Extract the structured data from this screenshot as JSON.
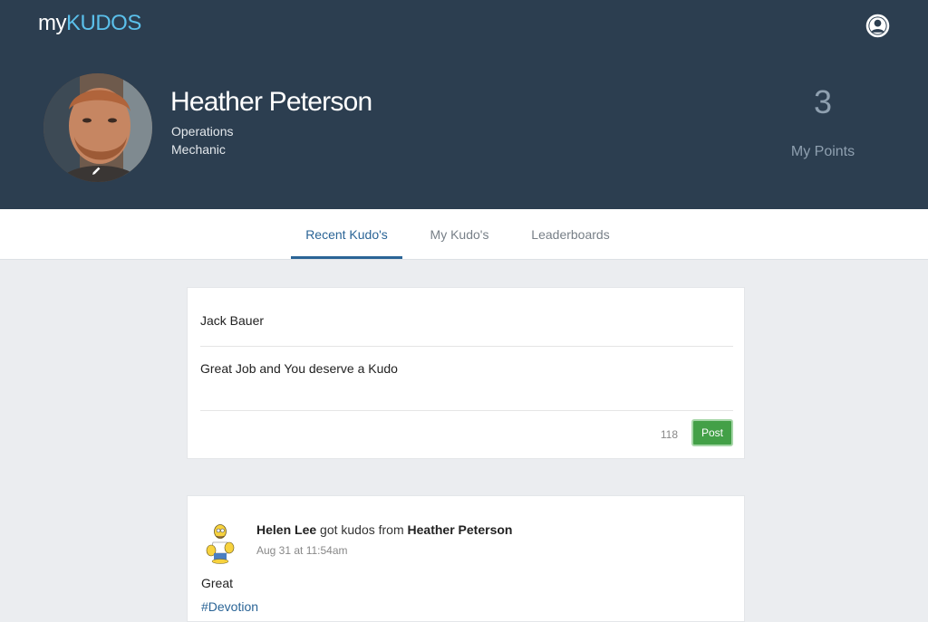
{
  "app": {
    "logo_prefix": "my",
    "logo_accent": "KUDOS",
    "accent_color": "#5bc0eb",
    "header_color": "#2c3e50"
  },
  "header": {
    "user_menu_icon": "user-circle-icon"
  },
  "profile": {
    "name": "Heather Peterson",
    "department": "Operations",
    "role": "Mechanic",
    "avatar_edit_icon": "pencil-icon",
    "points_value": "3",
    "points_label": "My Points"
  },
  "tabs": [
    {
      "label": "Recent Kudo's",
      "active": true
    },
    {
      "label": "My Kudo's",
      "active": false
    },
    {
      "label": "Leaderboards",
      "active": false
    }
  ],
  "composer": {
    "recipient_value": "Jack Bauer",
    "message_value": "Great Job and You deserve a Kudo",
    "char_count": "118",
    "post_label": "Post",
    "post_color": "#43a047"
  },
  "feed": [
    {
      "recipient": "Helen Lee",
      "verb": "got kudos from",
      "sender": "Heather Peterson",
      "timestamp": "Aug 31 at 11:54am",
      "message": "Great",
      "tag": "#Devotion",
      "avatar_icon": "cartoon-avatar-icon"
    }
  ]
}
